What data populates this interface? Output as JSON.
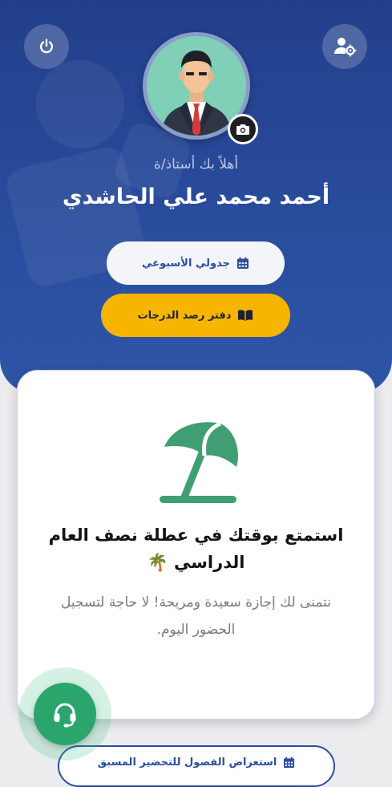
{
  "header": {
    "greeting": "أهلاً بك أستاذ/ة",
    "teacher_name": "أحمد محمد علي الحاشدي",
    "schedule_button": "جدولي الأسبوعي",
    "gradebook_button": "دفتر رصد الدرجات"
  },
  "card": {
    "emoji": "🌴",
    "title": "استمتع بوقتك في عطلة نصف العام الدراسي",
    "message": "نتمنى لك إجازة سعيدة ومريحة! لا حاجة لتسجيل الحضور اليوم."
  },
  "bottom": {
    "preparation_button": "استعراض الفصول للتحضير المسبق"
  },
  "colors": {
    "header_blue": "#2a4d9e",
    "accent_yellow": "#f7b500",
    "umbrella_green": "#3f9f73",
    "support_green": "#2aa66d"
  },
  "icons": [
    "power-icon",
    "user-settings-icon",
    "camera-icon",
    "calendar-icon",
    "book-icon",
    "beach-umbrella-icon",
    "headset-icon"
  ]
}
